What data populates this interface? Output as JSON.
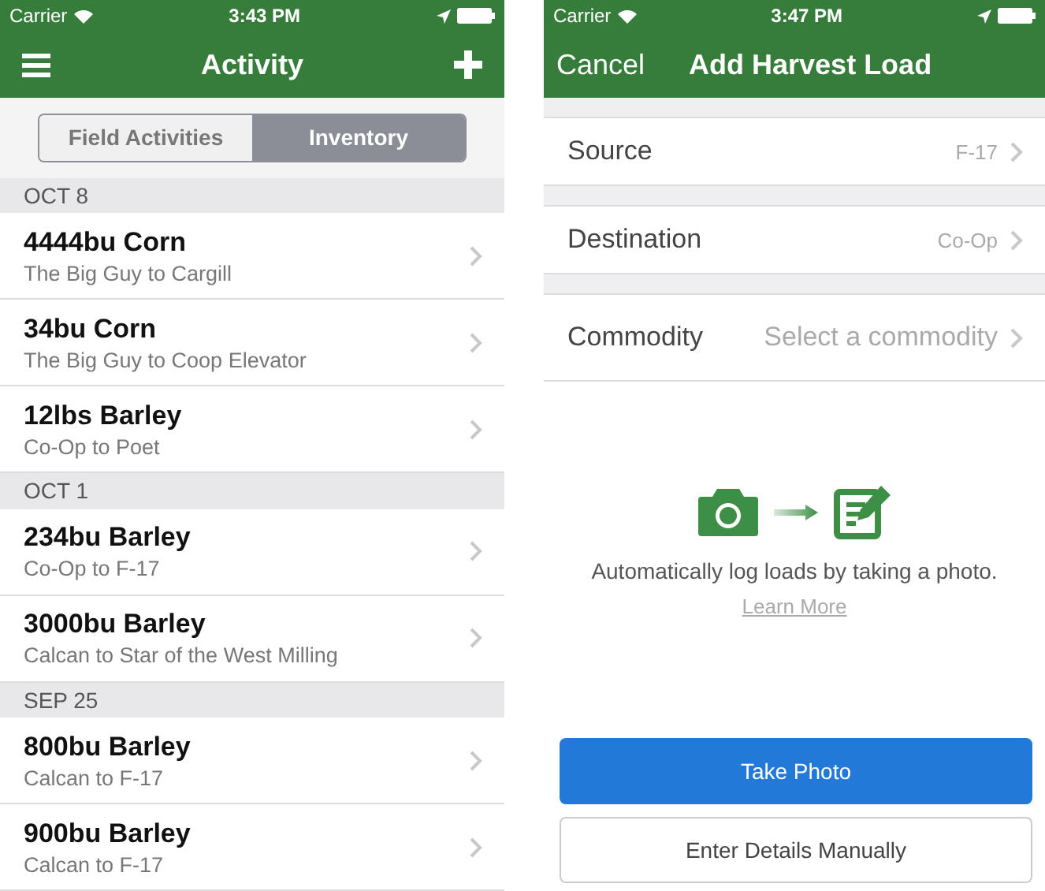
{
  "left_screen": {
    "status_bar": {
      "carrier": "Carrier",
      "time": "3:43 PM"
    },
    "nav_bar": {
      "title": "Activity"
    },
    "segments": [
      {
        "label": "Field Activities",
        "selected": false
      },
      {
        "label": "Inventory",
        "selected": true
      }
    ],
    "sections": [
      {
        "header": "OCT 8",
        "rows": [
          {
            "title": "4444bu Corn",
            "subtitle": "The Big Guy to Cargill"
          },
          {
            "title": "34bu Corn",
            "subtitle": "The Big Guy to Coop Elevator"
          },
          {
            "title": "12lbs Barley",
            "subtitle": "Co-Op to Poet"
          }
        ]
      },
      {
        "header": "OCT 1",
        "rows": [
          {
            "title": "234bu Barley",
            "subtitle": "Co-Op to F-17"
          },
          {
            "title": "3000bu Barley",
            "subtitle": "Calcan to Star of the West Milling"
          }
        ]
      },
      {
        "header": "SEP 25",
        "rows": [
          {
            "title": "800bu Barley",
            "subtitle": "Calcan to F-17"
          },
          {
            "title": "900bu Barley",
            "subtitle": "Calcan to F-17"
          }
        ]
      }
    ]
  },
  "right_screen": {
    "status_bar": {
      "carrier": "Carrier",
      "time": "3:47 PM"
    },
    "nav_bar": {
      "cancel": "Cancel",
      "title": "Add Harvest Load"
    },
    "fields": [
      {
        "label": "Source",
        "value": "F-17",
        "kind": "value"
      },
      {
        "label": "Destination",
        "value": "Co-Op",
        "kind": "value"
      },
      {
        "label": "Commodity",
        "value": "Select a commodity",
        "kind": "placeholder"
      }
    ],
    "hint": "Automatically log loads by taking a photo.",
    "learn_more": "Learn More",
    "buttons": [
      {
        "label": "Take Photo",
        "kind": "primary"
      },
      {
        "label": "Enter Details Manually",
        "kind": "secondary"
      }
    ]
  }
}
